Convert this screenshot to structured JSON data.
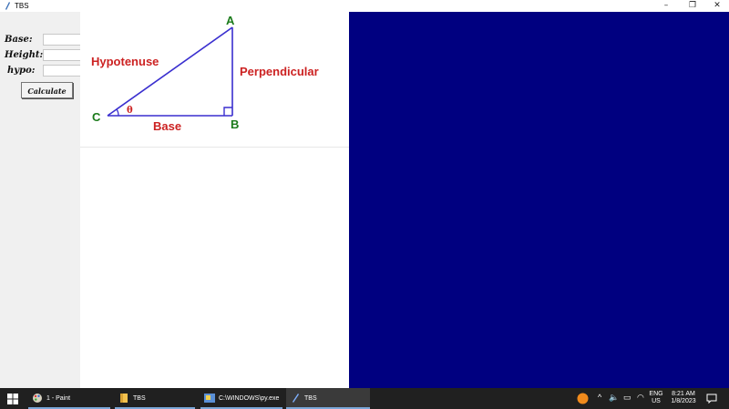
{
  "window": {
    "title": "TBS"
  },
  "form": {
    "base_label": "Base:",
    "height_label": "Height:",
    "hypo_label": "hypo:",
    "base_value": "",
    "height_value": "",
    "hypo_value": "",
    "calculate_label": "Calculate"
  },
  "diagram": {
    "vertex_a": "A",
    "vertex_b": "B",
    "vertex_c": "C",
    "hypotenuse": "Hypotenuse",
    "perpendicular": "Perpendicular",
    "base": "Base",
    "angle": "θ"
  },
  "colors": {
    "right_canvas": "#000080",
    "label_red": "#cc2222",
    "vertex_green": "#1a7a1a",
    "triangle_line": "#3a2fcf"
  },
  "taskbar": {
    "items": [
      {
        "label": "1 - Paint",
        "icon": "paint-icon"
      },
      {
        "label": "TBS",
        "icon": "folder-icon"
      },
      {
        "label": "C:\\WINDOWS\\py.exe",
        "icon": "python-console-icon"
      },
      {
        "label": "TBS",
        "icon": "python-feather-icon"
      }
    ],
    "lang_top": "ENG",
    "lang_bottom": "US",
    "time": "8:21 AM",
    "date": "1/8/2023"
  }
}
